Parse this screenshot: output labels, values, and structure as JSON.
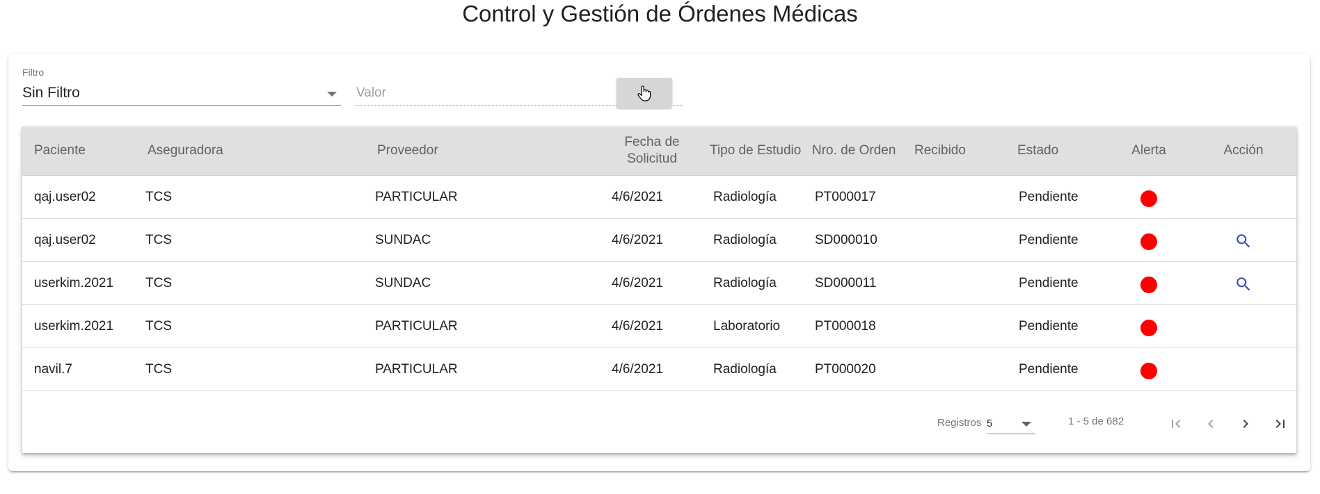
{
  "page": {
    "title": "Control y Gestión de Órdenes Médicas"
  },
  "filter": {
    "label": "Filtro",
    "selected": "Sin Filtro",
    "value_placeholder": "Valor",
    "value": ""
  },
  "table": {
    "headers": {
      "paciente": "Paciente",
      "aseguradora": "Aseguradora",
      "proveedor": "Proveedor",
      "fecha": "Fecha de Solicitud",
      "tipo": "Tipo de Estudio",
      "orden": "Nro. de Orden",
      "recibido": "Recibido",
      "estado": "Estado",
      "alerta": "Alerta",
      "accion": "Acción"
    },
    "rows": [
      {
        "paciente": "qaj.user02",
        "aseguradora": "TCS",
        "proveedor": "PARTICULAR",
        "fecha": "4/6/2021",
        "tipo": "Radiología",
        "orden": "PT000017",
        "recibido": "",
        "estado": "Pendiente",
        "alert_color": "#ff0000",
        "action_icon": ""
      },
      {
        "paciente": "qaj.user02",
        "aseguradora": "TCS",
        "proveedor": "SUNDAC",
        "fecha": "4/6/2021",
        "tipo": "Radiología",
        "orden": "SD000010",
        "recibido": "",
        "estado": "Pendiente",
        "alert_color": "#ff0000",
        "action_icon": "search-icon"
      },
      {
        "paciente": "userkim.2021",
        "aseguradora": "TCS",
        "proveedor": "SUNDAC",
        "fecha": "4/6/2021",
        "tipo": "Radiología",
        "orden": "SD000011",
        "recibido": "",
        "estado": "Pendiente",
        "alert_color": "#ff0000",
        "action_icon": "search-icon"
      },
      {
        "paciente": "userkim.2021",
        "aseguradora": "TCS",
        "proveedor": "PARTICULAR",
        "fecha": "4/6/2021",
        "tipo": "Laboratorio",
        "orden": "PT000018",
        "recibido": "",
        "estado": "Pendiente",
        "alert_color": "#ff0000",
        "action_icon": ""
      },
      {
        "paciente": "navil.7",
        "aseguradora": "TCS",
        "proveedor": "PARTICULAR",
        "fecha": "4/6/2021",
        "tipo": "Radiología",
        "orden": "PT000020",
        "recibido": "",
        "estado": "Pendiente",
        "alert_color": "#ff0000",
        "action_icon": ""
      }
    ]
  },
  "paginator": {
    "label": "Registros",
    "page_size": "5",
    "range": "1 - 5 de 682"
  },
  "colors": {
    "alert": "#ff0000",
    "action_icon": "#3f51b5",
    "header_bg": "#e0e0e0"
  }
}
